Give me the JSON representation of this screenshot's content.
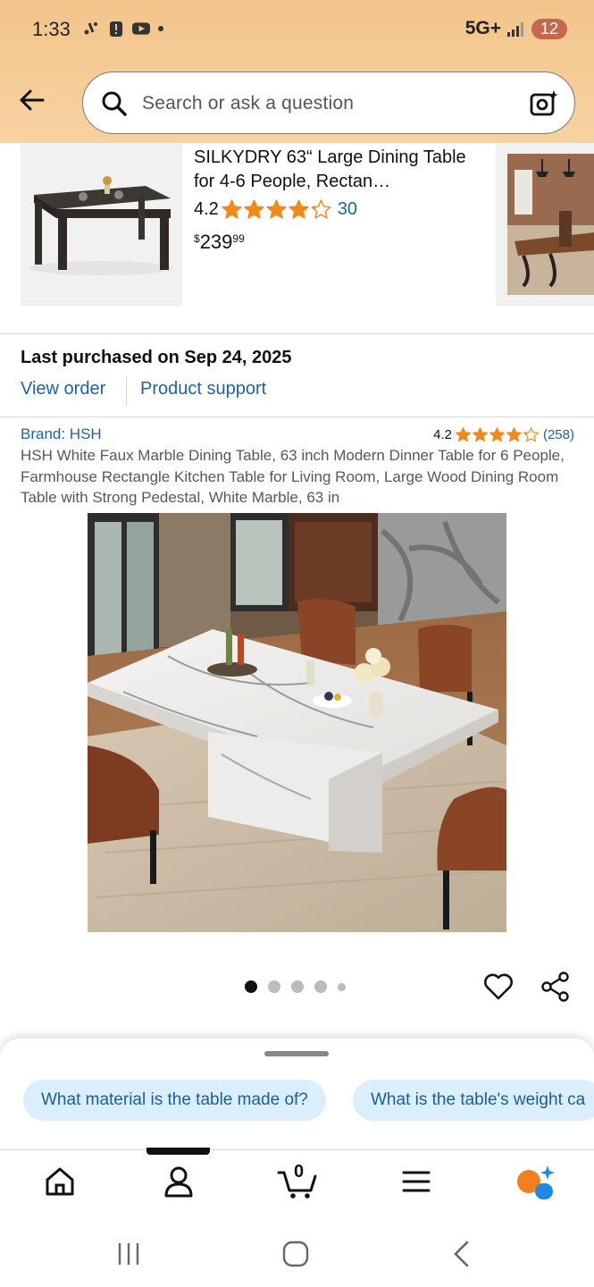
{
  "status_bar": {
    "time": "1:33",
    "network": "5G+",
    "battery": "12"
  },
  "search": {
    "placeholder": "Search or ask a question"
  },
  "product_top": {
    "title": "SILKYDRY 63“ Large Dining Table for 4-6 People, Rectan…",
    "rating": "4.2",
    "review_count": "30",
    "price_currency": "$",
    "price_whole": "239",
    "price_fraction": "99"
  },
  "last_purchased": {
    "title": "Last purchased on Sep 24, 2025",
    "view_order": "View order",
    "product_support": "Product support"
  },
  "product_main": {
    "brand": "Brand: HSH",
    "rating": "4.2",
    "review_count": "(258)",
    "title": "HSH White Faux Marble Dining Table, 63 inch Modern Dinner Table for 6 People, Farmhouse Rectangle Kitchen Table for Living Room, Large Wood Dining Room Table with Strong Pedestal, White Marble, 63 in",
    "image_count": 5,
    "active_image": 1
  },
  "suggestions": {
    "chips": [
      "What material is the table made of?",
      "What is the table's weight ca"
    ]
  },
  "bottom_nav": {
    "items": [
      "home-icon",
      "account-icon",
      "cart-icon",
      "menu-icon",
      "rufus-ai-icon"
    ],
    "cart_count": "0"
  },
  "colors": {
    "header": "#f2c48a",
    "link": "#2162a1",
    "star": "#f08a1c",
    "chip_bg": "#dbeefb"
  }
}
